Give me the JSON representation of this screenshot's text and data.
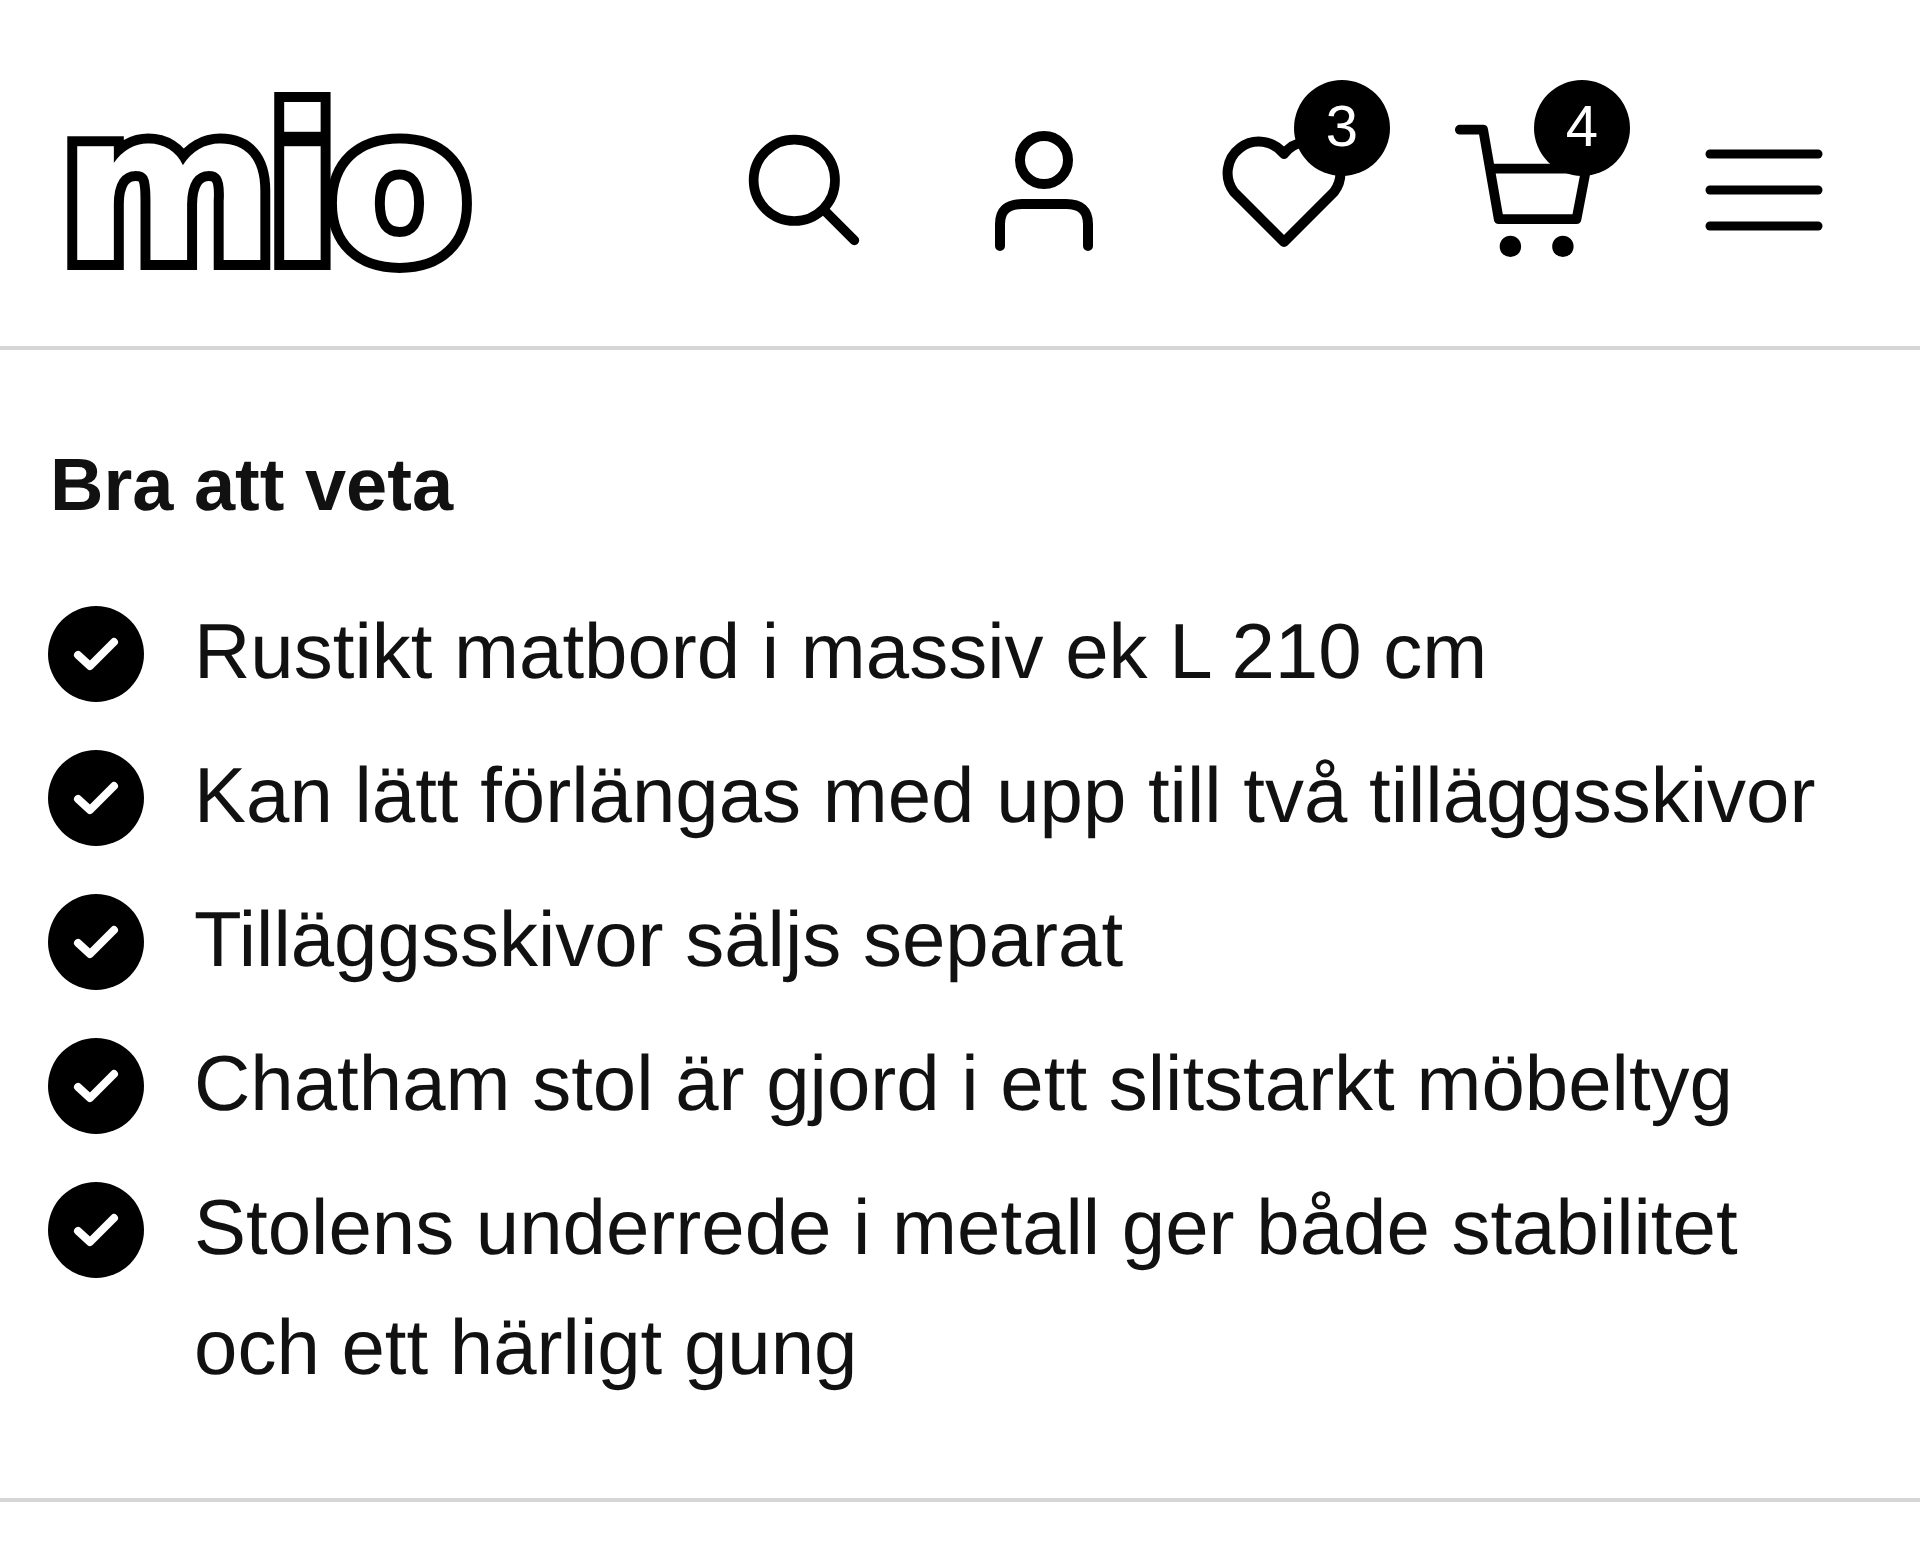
{
  "logo": {
    "text": "mio"
  },
  "header": {
    "actions": [
      {
        "kind": "search"
      },
      {
        "kind": "account"
      },
      {
        "kind": "wishlist",
        "count": "3"
      },
      {
        "kind": "cart",
        "count": "4"
      },
      {
        "kind": "menu"
      }
    ]
  },
  "section": {
    "title": "Bra att veta",
    "items": [
      "Rustikt matbord i massiv ek L 210 cm",
      "Kan lätt förlängas med upp till två tilläggsskivor",
      "Tilläggsskivor säljs separat",
      "Chatham stol är gjord i ett slitstarkt möbeltyg",
      "Stolens underrede i metall ger både stabilitet och ett härligt gung"
    ]
  }
}
